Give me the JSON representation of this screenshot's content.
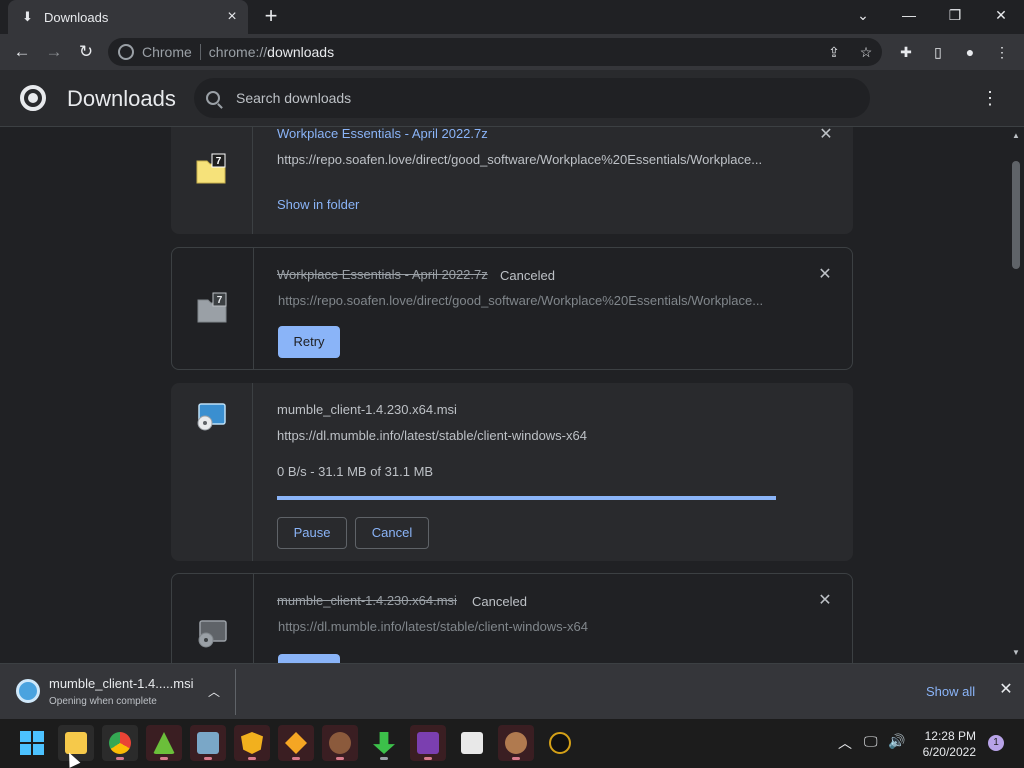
{
  "tab": {
    "title": "Downloads",
    "icon": "download-icon"
  },
  "window_controls": {
    "tab_search": "⌄",
    "minimize": "—",
    "restore": "❐",
    "close": "✕"
  },
  "toolbar": {
    "chip": "Chrome",
    "url_scheme": "chrome://",
    "url_host": "downloads"
  },
  "header": {
    "title": "Downloads",
    "search_placeholder": "Search downloads"
  },
  "downloads": [
    {
      "name": "Workplace Essentials - April 2022.7z",
      "status": "",
      "url": "https://repo.soafen.love/direct/good_software/Workplace%20Essentials/Workplace...",
      "action": "Show in folder"
    },
    {
      "name": "Workplace Essentials - April 2022.7z",
      "status": "Canceled",
      "url": "https://repo.soafen.love/direct/good_software/Workplace%20Essentials/Workplace...",
      "action": "Retry"
    },
    {
      "name": "mumble_client-1.4.230.x64.msi",
      "status": "",
      "url": "https://dl.mumble.info/latest/stable/client-windows-x64",
      "progress_text": "0 B/s - 31.1 MB of 31.1 MB",
      "progress": 1.0,
      "action_pause": "Pause",
      "action_cancel": "Cancel"
    },
    {
      "name": "mumble_client-1.4.230.x64.msi",
      "status": "Canceled",
      "url": "https://dl.mumble.info/latest/stable/client-windows-x64"
    }
  ],
  "shelf": {
    "file": "mumble_client-1.4.....msi",
    "sub": "Opening when complete",
    "show_all": "Show all"
  },
  "taskbar": {
    "time": "12:28 PM",
    "date": "6/20/2022",
    "notifications": "1"
  },
  "colors": {
    "accent": "#8ab4f8",
    "background": "#202124",
    "surface": "#292a2d"
  }
}
